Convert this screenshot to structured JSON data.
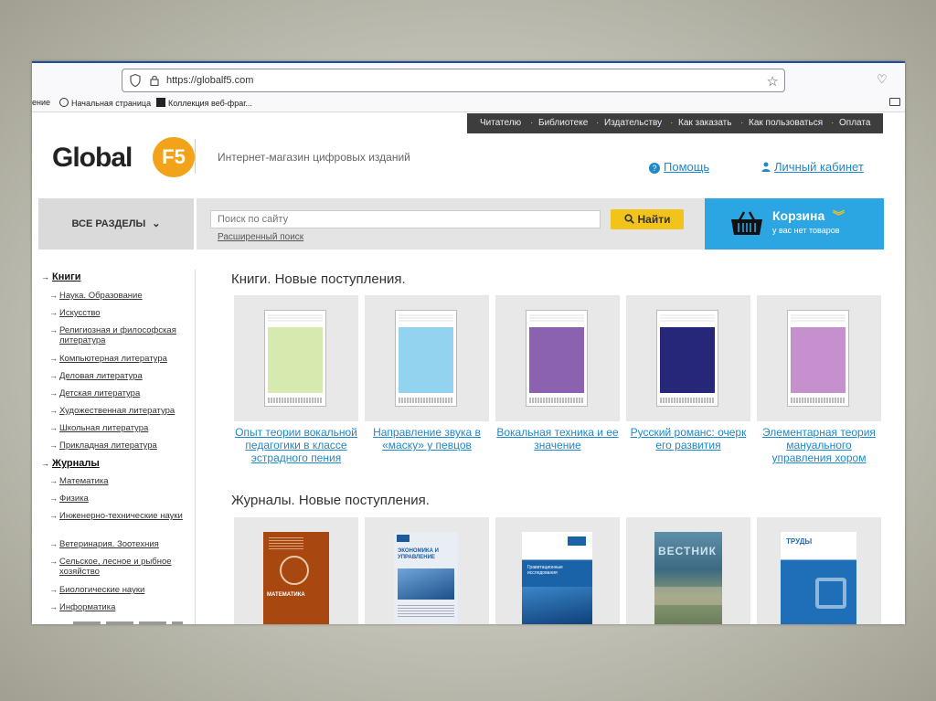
{
  "browser": {
    "url": "https://globalf5.com",
    "bookmarks": [
      "ение",
      "Начальная страница",
      "Коллекция веб-фраг..."
    ]
  },
  "topnav": [
    "Читателю",
    "Библиотеке",
    "Издательству",
    "Как заказать",
    "Как пользоваться",
    "Оплата"
  ],
  "header": {
    "logo_text": "Global",
    "logo_badge": "F5",
    "tagline": "Интернет-магазин цифровых изданий",
    "help": "Помощь",
    "cabinet": "Личный кабинет"
  },
  "search": {
    "all_sections": "ВСЕ РАЗДЕЛЫ",
    "placeholder": "Поиск по сайту",
    "button": "Найти",
    "advanced": "Расширенный поиск"
  },
  "cart": {
    "title": "Корзина",
    "subtitle": "у вас нет товаров"
  },
  "sidebar": [
    {
      "label": "Книги",
      "level": 1
    },
    {
      "label": "Наука. Образование",
      "level": 2
    },
    {
      "label": "Искусство",
      "level": 2
    },
    {
      "label": "Религиозная и философская литература",
      "level": 2
    },
    {
      "label": "Компьютерная литература",
      "level": 2
    },
    {
      "label": "Деловая литература",
      "level": 2
    },
    {
      "label": "Детская литература",
      "level": 2
    },
    {
      "label": "Художественная литература",
      "level": 2
    },
    {
      "label": "Школьная литература",
      "level": 2
    },
    {
      "label": "Прикладная литература",
      "level": 2
    },
    {
      "label": "Журналы",
      "level": 1
    },
    {
      "label": "Математика",
      "level": 2
    },
    {
      "label": "Физика",
      "level": 2
    },
    {
      "label": "Инженерно-технические науки",
      "level": 2
    },
    {
      "label": "Ветеринария. Зоотехния",
      "level": 2
    },
    {
      "label": "Сельское, лесное и рыбное хозяйство",
      "level": 2
    },
    {
      "label": "Биологические науки",
      "level": 2
    },
    {
      "label": "Информатика",
      "level": 2
    }
  ],
  "books": {
    "title": "Книги. Новые поступления.",
    "items": [
      {
        "title": "Опыт теории вокальной педагогики в классе эстрадного пения",
        "color": "#d6eab0"
      },
      {
        "title": "Направление звука в «маску» у певцов",
        "color": "#93d3f0"
      },
      {
        "title": "Вокальная техника и ее значение",
        "color": "#8a62b0"
      },
      {
        "title": "Русский романс: очерк его развития",
        "color": "#27277a"
      },
      {
        "title": "Элементарная теория мануального управления хором",
        "color": "#c690cf"
      }
    ]
  },
  "journals": {
    "title": "Журналы. Новые поступления.",
    "items": [
      {
        "name": "МАТЕМАТИКА",
        "color": "#a8470f"
      },
      {
        "name": "ЭКОНОМИКА И УПРАВЛЕНИЕ",
        "color": "#e9eef4"
      },
      {
        "name": "Гравитационные исследования",
        "color": "#1a63a8"
      },
      {
        "name": "ВЕСТНИК",
        "color": "#4d7a8e"
      },
      {
        "name": "ТРУДЫ",
        "color": "#1e6fb8"
      }
    ]
  }
}
